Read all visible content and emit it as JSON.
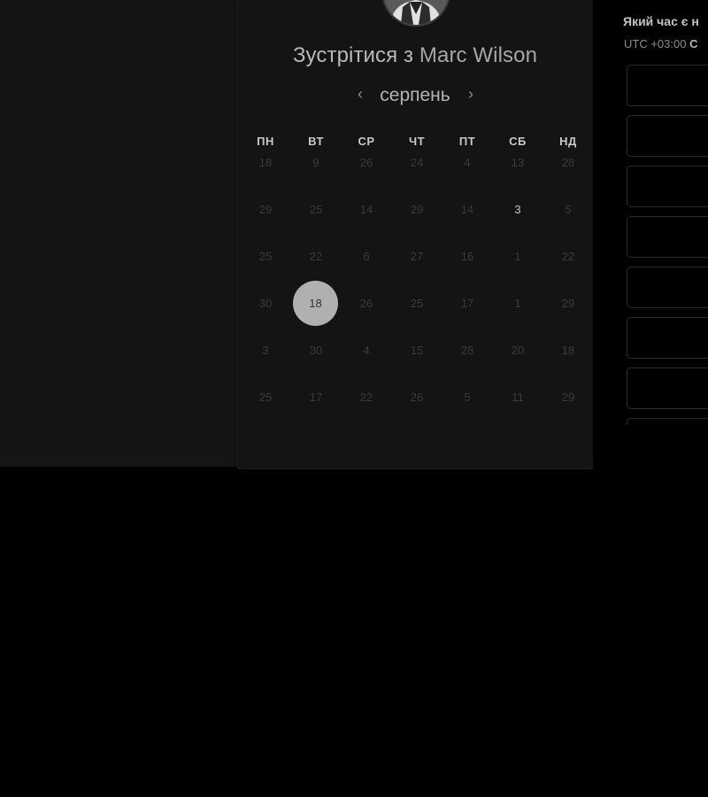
{
  "booking": {
    "title_prefix": "Зустрітися з",
    "host_name": "Marc Wilson"
  },
  "calendar": {
    "month": "серпень",
    "weekdays": [
      "ПН",
      "ВТ",
      "СР",
      "ЧТ",
      "ПТ",
      "СБ",
      "НД"
    ],
    "weeks": [
      [
        "18",
        "9",
        "26",
        "24",
        "4",
        "13",
        "28"
      ],
      [
        "29",
        "25",
        "14",
        "29",
        "14",
        "3",
        "5"
      ],
      [
        "25",
        "22",
        "6",
        "27",
        "16",
        "1",
        "22"
      ],
      [
        "30",
        "18",
        "26",
        "25",
        "17",
        "1",
        "29"
      ],
      [
        "3",
        "30",
        "4",
        "15",
        "28",
        "20",
        "18"
      ],
      [
        "25",
        "17",
        "22",
        "26",
        "5",
        "11",
        "29"
      ]
    ],
    "available": [
      [
        1,
        5
      ]
    ],
    "selected": [
      3,
      1
    ]
  },
  "schedule": {
    "heading": "Який час є н",
    "tz_offset": "UTC +03:00",
    "tz_name": "C",
    "slot_count": 8
  },
  "colors": {
    "background": "#000000",
    "panel": "#151515",
    "selected_day": "#b0b0b0"
  }
}
